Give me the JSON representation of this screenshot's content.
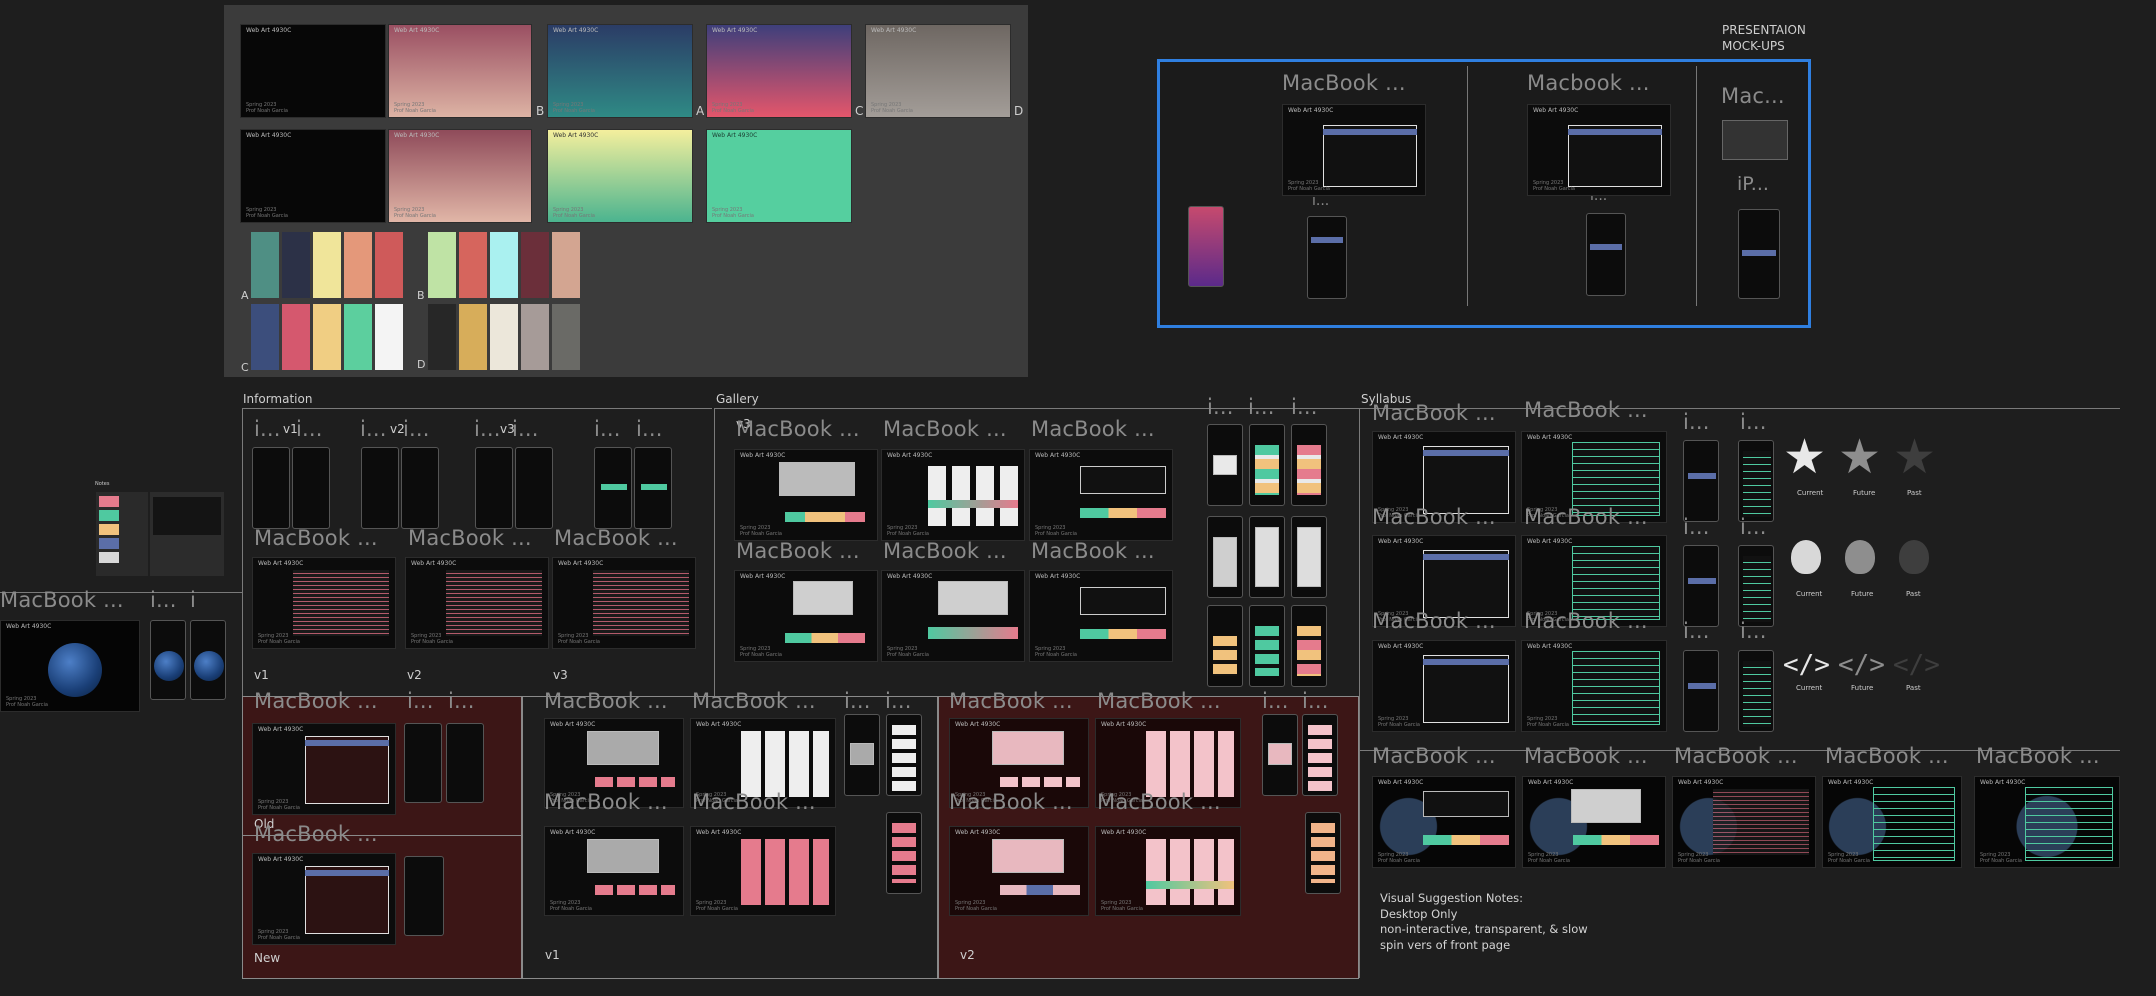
{
  "frame_title": "Web Art 4930C",
  "footer": "Spring 2023\nProf Noah Garcia",
  "moodboard": {
    "variant_letters": [
      "A",
      "B",
      "C",
      "D"
    ],
    "palette_labels": [
      "A",
      "B",
      "C",
      "D"
    ]
  },
  "presentation": {
    "title_line1": "PRESENTAION",
    "title_line2": "MOCK-UPS",
    "macbook1": "MacBook ...",
    "macbook2": "Macbook ...",
    "macbook3": "Mac...",
    "iphone": "iP...",
    "ellipsis": "i..."
  },
  "sections": {
    "information": "Information",
    "gallery": "Gallery",
    "syllabus": "Syllabus",
    "notes": "Notes"
  },
  "labels": {
    "macbook": "MacBook ...",
    "ellipsis_i": "i...",
    "ellipsis_short": "i",
    "v1": "v1",
    "v2": "v2",
    "v3": "v3",
    "old": "Old",
    "new": "New"
  },
  "icons_legend": [
    "Current",
    "Future",
    "Past"
  ],
  "visual_notes": [
    "Visual Suggestion Notes:",
    "Desktop Only",
    "non-interactive, transparent, & slow",
    "spin vers of front page"
  ],
  "colors": {
    "canvas_bg": "#1e1e1e",
    "moodboard_bg": "#3b3b3b",
    "selection_blue": "#2f7fe0",
    "red_section": "#3c1616",
    "accent_teal": "#4fc9a0",
    "accent_blue": "#5b6ea8",
    "accent_pink": "#e57b8d",
    "accent_yellow": "#f1c27d"
  },
  "palettes": {
    "A": [
      "#4f8f84",
      "#2c3147",
      "#f0e59a",
      "#e4987a",
      "#cf5a5a"
    ],
    "B": [
      "#bfe3a5",
      "#d6655d",
      "#aaf1f0",
      "#6b2f3a",
      "#d3a591"
    ],
    "C": [
      "#3c4e7c",
      "#d5586e",
      "#f0ce83",
      "#5ccf9e",
      "#f4f4f4"
    ],
    "D": [
      "#272727",
      "#d7ad5a",
      "#ece7da",
      "#a69b98",
      "#6a6a66"
    ]
  }
}
